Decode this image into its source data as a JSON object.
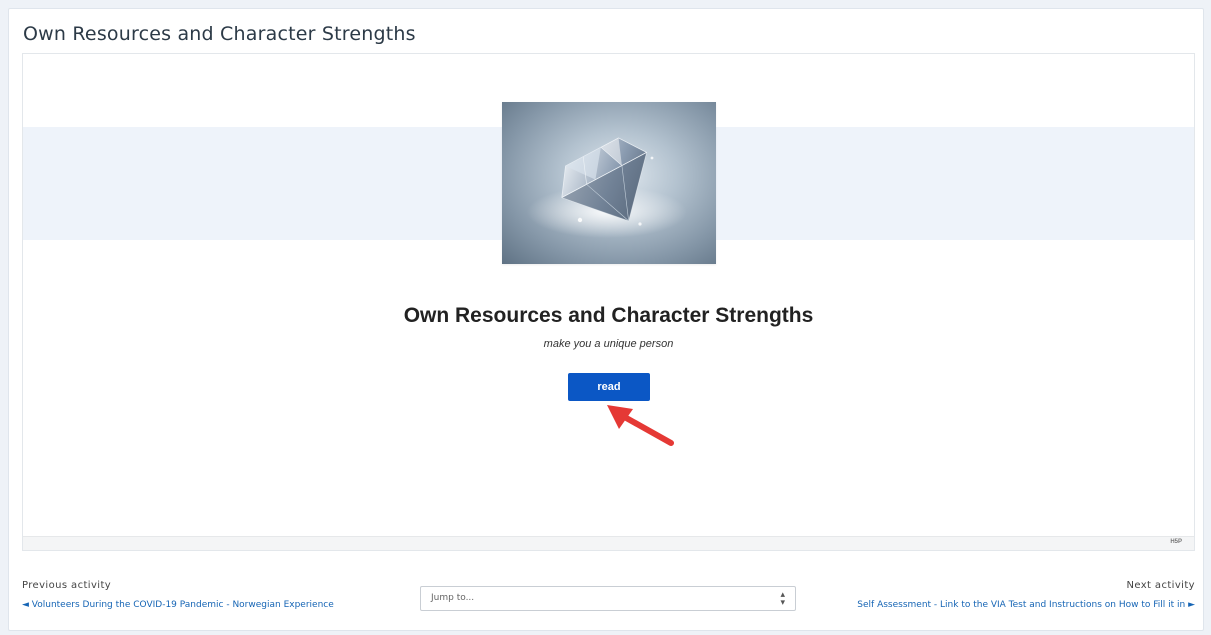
{
  "page": {
    "title": "Own Resources and Character Strengths"
  },
  "activity": {
    "headline": "Own Resources and Character Strengths",
    "subline": "make you a unique person",
    "read_label": "read",
    "image_icon": "diamond-image",
    "footer_badge": "H5P"
  },
  "nav": {
    "prev_label": "Previous activity",
    "prev_link": "◄ Volunteers During the COVID-19 Pandemic - Norwegian Experience",
    "jump_placeholder": "Jump to...",
    "jump_caret_up": "▴",
    "jump_caret_down": "▾",
    "next_label": "Next activity",
    "next_link": "Self Assessment - Link to the VIA Test and Instructions on How to Fill it in ►"
  },
  "colors": {
    "accent": "#0b57c5",
    "link": "#1665b5",
    "band": "#eef3fa",
    "arrow": "#e53935"
  }
}
